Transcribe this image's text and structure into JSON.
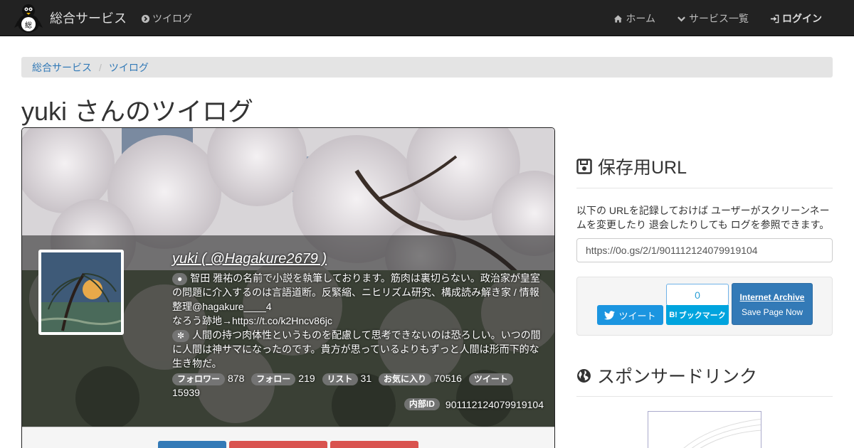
{
  "nav": {
    "brand": "総合サービス",
    "tsuilog": "ツイログ",
    "home": "ホーム",
    "services": "サービス一覧",
    "login": "ログイン"
  },
  "breadcrumb": [
    "総合サービス",
    "ツイログ"
  ],
  "page_title": "yuki さんのツイログ",
  "profile": {
    "name": "yuki ( @Hagakure2679 )",
    "bio_line1": "智田 雅祐の名前で小説を執筆しております。筋肉は裏切らない。政治家が皇室の問題に介入するのは言語道断。反緊縮、ニヒリズム研究、構成読み解き家 / 情報整理@hagakure____4",
    "bio_line2": "なろう跡地→https://t.co/k2Hncv86jc",
    "tweet_text": "人間の持つ肉体性というものを配慮して思考できないのは恐ろしい。いつの間に人間は神サマになったのです。貴方が思っているよりもずっと人間は形而下的な生き物だ。",
    "stats": [
      {
        "label": "フォロワー",
        "value": "878"
      },
      {
        "label": "フォロー",
        "value": "219"
      },
      {
        "label": "リスト",
        "value": "31"
      },
      {
        "label": "お気に入り",
        "value": "70516"
      },
      {
        "label": "ツイート",
        "value": "15939"
      }
    ],
    "internal_id_label": "内部ID",
    "internal_id": "901112124079919104"
  },
  "sidebar": {
    "save_heading": "保存用URL",
    "save_desc": "以下の URLを記録しておけば ユーザーがスクリーンネームを変更したり 退会したりしても ログを参照できます。",
    "save_url": "https://0o.gs/2/1/901112124079919104",
    "tweet_label": "ツイート",
    "hatena_count": "0",
    "hatena_label": "ブックマーク",
    "ia_title": "Internet Archive",
    "ia_sub": "Save Page Now",
    "sponsor_heading": "スポンサードリンク"
  },
  "colors": {
    "navbar": "#222222",
    "link": "#337ab7",
    "twitter": "#1b95e0",
    "hatena": "#00a4de",
    "primary": "#337ab7",
    "danger": "#d9534f"
  }
}
